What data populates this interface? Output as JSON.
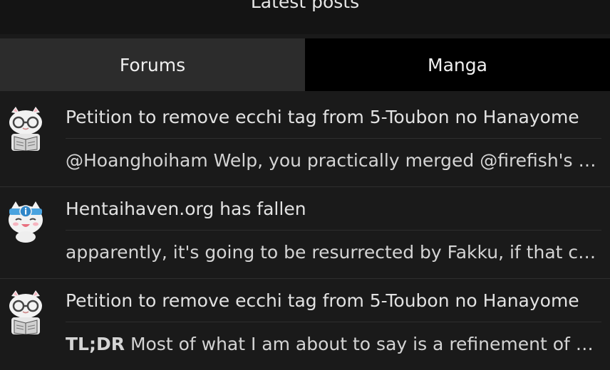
{
  "header": {
    "title": "Latest posts"
  },
  "tabs": [
    {
      "label": "Forums",
      "active": true
    },
    {
      "label": "Manga",
      "active": false
    }
  ],
  "posts": [
    {
      "avatar_icon": "cat-reading-glasses-avatar",
      "topic": "Petition to remove ecchi tag from 5-Toubon no Hanayome",
      "reply_prefix": "",
      "reply": "@Hoanghoiham Welp, you practically merged @firefish's comment"
    },
    {
      "avatar_icon": "cat-info-headband-avatar",
      "topic": "Hentaihaven.org has fallen",
      "reply_prefix": "",
      "reply": "apparently, it's going to be resurrected by Fakku, if that counts"
    },
    {
      "avatar_icon": "cat-reading-glasses-avatar",
      "topic": "Petition to remove ecchi tag from 5-Toubon no Hanayome",
      "reply_prefix": "TL;DR",
      "reply": "Most of what I am about to say is a refinement of what was said"
    }
  ]
}
